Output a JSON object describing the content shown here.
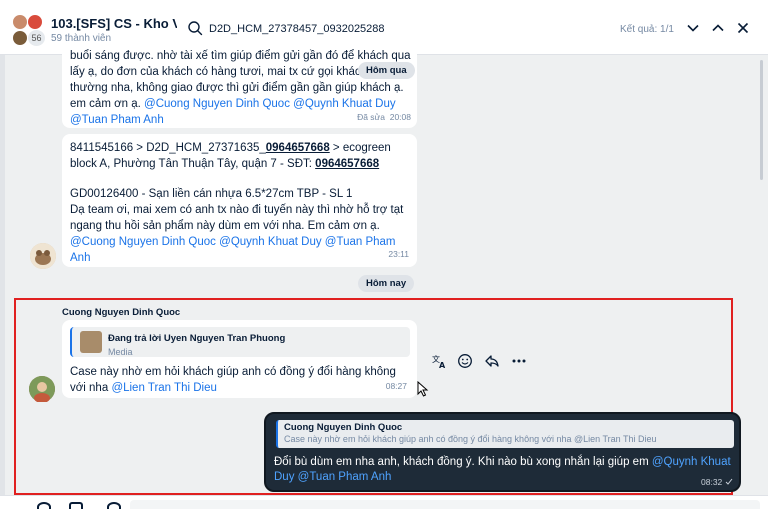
{
  "header": {
    "group_title": "103.[SFS] CS - Kho Vận",
    "member_count_badge": "56",
    "members_label": "59 thành viên",
    "search_value": "D2D_HCM_27378457_0932025288",
    "result_text": "Kết quả: 1/1"
  },
  "messages": {
    "msg1": {
      "line1": "buổi sáng được. nhờ tài xế tìm giúp điểm gửi gần đó để khách qua",
      "line2": "lấy ạ, do đơn của khách có hàng tươi, mai tx cứ gọi khách",
      "line3": "thường nha, không giao được thì gửi điểm gần gần giúp khách ạ.",
      "line4": "em cảm ơn ạ.",
      "mention1": "@Cuong Nguyen Dinh Quoc",
      "mention2": "@Quynh Khuat Duy",
      "mention3": "@Tuan Pham Anh",
      "edited": "Đã sửa",
      "time": "20:08",
      "date_chip": "Hôm qua"
    },
    "msg2": {
      "line1_pre": "8411545166 > D2D_HCM_27371635_",
      "phone1": "0964657668",
      "line1_post": " > ecogreen",
      "line2_pre": "block A, Phường Tân Thuận Tây, quận 7 - SĐT: ",
      "phone2": "0964657668",
      "line3": "GD00126400 - Sạn liền cán nhựa 6.5*27cm TBP - SL 1",
      "line4": "Dạ team ơi, mai  xem có anh tx nào đi tuyến này thì nhờ hỗ trợ tạt",
      "line5": "ngang thu hồi sản phẩm này dùm em với nha. Em cảm ơn ạ.",
      "mention1": "@Cuong Nguyen Dinh Quoc",
      "mention2": "@Quynh Khuat Duy",
      "mention3": "@Tuan Pham",
      "mention3b": "Anh",
      "time": "23:11"
    },
    "today_chip": "Hôm nay",
    "msg3": {
      "sender": "Cuong Nguyen Dinh Quoc",
      "reply_label": "Đang trả lời Uyen Nguyen Tran Phuong",
      "reply_media": "Media",
      "line1": "Case này nhờ em hỏi khách giúp anh có đồng ý đổi hàng không",
      "line2": "với nha",
      "mention": "@Lien Tran Thi Dieu",
      "time": "08:27"
    },
    "msg4": {
      "quote_sender": "Cuong Nguyen Dinh Quoc",
      "quote_text": "Case này nhờ em hỏi khách giúp anh có đồng ý đổi hàng không với nha @Lien Tran Thi Dieu",
      "line1": "Đổi bù dùm em nha anh, khách đồng ý. Khi nào bù xong nhắn lại giúp em",
      "mention1": "@Quynh Khuat",
      "mention1b": "Duy",
      "mention2": "@Tuan Pham Anh",
      "time": "08:32"
    }
  },
  "icons": {
    "search": "search-icon",
    "up": "chevron-up-icon",
    "down": "chevron-down-icon",
    "close": "close-icon",
    "translate": "translate-icon",
    "emoji": "emoji-icon",
    "reply": "reply-icon",
    "more": "more-icon"
  }
}
